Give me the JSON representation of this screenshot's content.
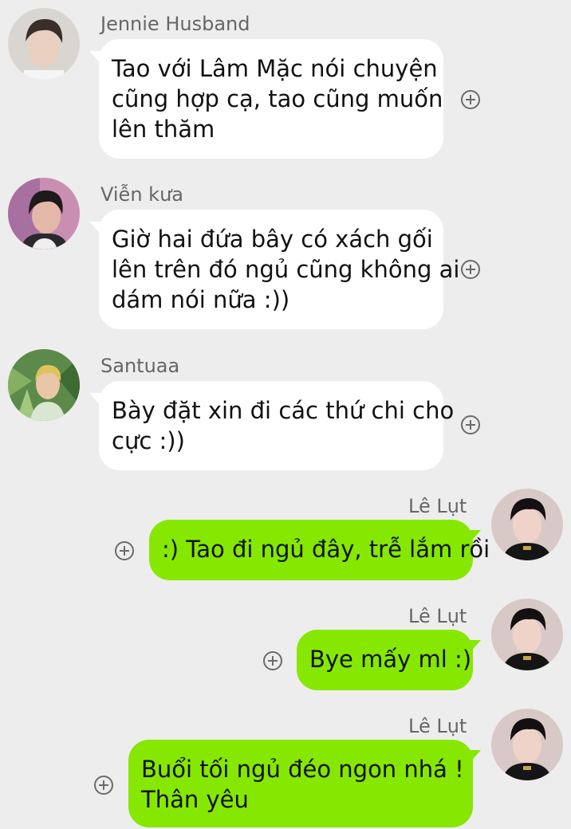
{
  "messages": [
    {
      "sender": "Jennie Husband",
      "direction": "incoming",
      "lines": [
        "Tao với Lâm Mặc nói chuyện",
        "cũng hợp cạ, tao cũng muốn",
        "lên thăm"
      ]
    },
    {
      "sender": "Viễn kưa",
      "direction": "incoming",
      "lines": [
        "Giờ hai đứa bây có xách gối",
        "lên trên đó ngủ cũng không ai",
        "dám nói nữa :))"
      ]
    },
    {
      "sender": "Santuaa",
      "direction": "incoming",
      "lines": [
        "Bày đặt xin đi các thứ chi cho",
        "cực :))"
      ]
    },
    {
      "sender": "Lê Lụt",
      "direction": "outgoing",
      "lines": [
        ":) Tao đi ngủ đây, trễ lắm rồi"
      ]
    },
    {
      "sender": "Lê Lụt",
      "direction": "outgoing",
      "lines": [
        "Bye mấy ml :)"
      ]
    },
    {
      "sender": "Lê Lụt",
      "direction": "outgoing",
      "lines": [
        "Buổi tối ngủ đéo ngon nhá !",
        "Thân yêu"
      ]
    }
  ],
  "colors": {
    "background": "#ededed",
    "incoming_bubble": "#ffffff",
    "outgoing_bubble": "#86e800",
    "sender_name": "#666666",
    "add_icon": "#6b6b6b"
  },
  "icons": {
    "add_reaction": "plus-circle-icon"
  }
}
